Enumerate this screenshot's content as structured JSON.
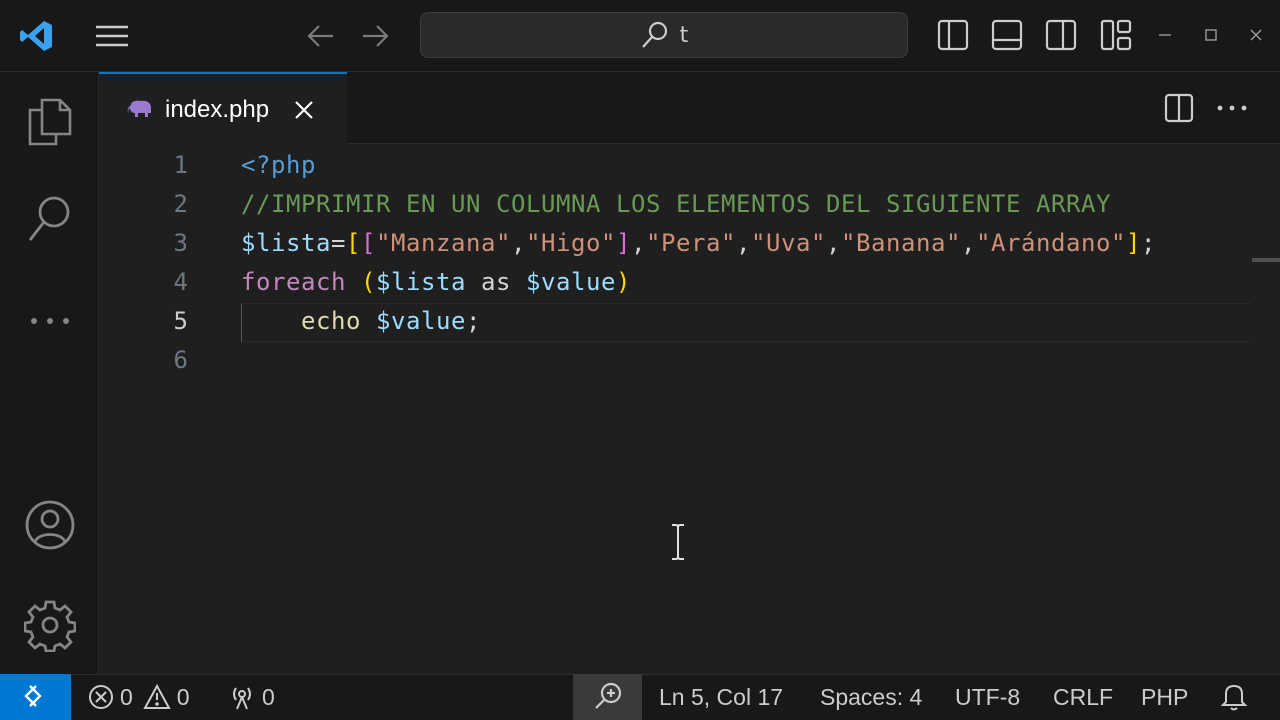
{
  "titlebar": {
    "search_text": "t"
  },
  "tab": {
    "label": "index.php",
    "icon": "php-elephant-icon"
  },
  "editor": {
    "line_numbers": [
      "1",
      "2",
      "3",
      "4",
      "5",
      "6"
    ],
    "active_line": 5,
    "lines": [
      {
        "segments": [
          {
            "cls": "k-tag",
            "text": "<?php"
          }
        ]
      },
      {
        "segments": [
          {
            "cls": "k-cmt",
            "text": "//IMPRIMIR EN UN COLUMNA LOS ELEMENTOS DEL SIGUIENTE ARRAY"
          }
        ]
      },
      {
        "segments": [
          {
            "cls": "k-var",
            "text": "$lista"
          },
          {
            "cls": "k-op",
            "text": "="
          },
          {
            "cls": "k-b1",
            "text": "["
          },
          {
            "cls": "k-b2",
            "text": "["
          },
          {
            "cls": "k-str",
            "text": "\"Manzana\""
          },
          {
            "cls": "k-op",
            "text": ","
          },
          {
            "cls": "k-str",
            "text": "\"Higo\""
          },
          {
            "cls": "k-b2",
            "text": "]"
          },
          {
            "cls": "k-op",
            "text": ","
          },
          {
            "cls": "k-str",
            "text": "\"Pera\""
          },
          {
            "cls": "k-op",
            "text": ","
          },
          {
            "cls": "k-str",
            "text": "\"Uva\""
          },
          {
            "cls": "k-op",
            "text": ","
          },
          {
            "cls": "k-str",
            "text": "\"Banana\""
          },
          {
            "cls": "k-op",
            "text": ","
          },
          {
            "cls": "k-str",
            "text": "\"Arándano\""
          },
          {
            "cls": "k-b1",
            "text": "]"
          },
          {
            "cls": "k-op",
            "text": ";"
          }
        ]
      },
      {
        "segments": [
          {
            "cls": "k-kw",
            "text": "foreach"
          },
          {
            "cls": "k-op",
            "text": " "
          },
          {
            "cls": "k-b1",
            "text": "("
          },
          {
            "cls": "k-var",
            "text": "$lista"
          },
          {
            "cls": "k-op",
            "text": " as "
          },
          {
            "cls": "k-var",
            "text": "$value"
          },
          {
            "cls": "k-b1",
            "text": ")"
          }
        ]
      },
      {
        "segments": [
          {
            "cls": "k-op",
            "text": "    "
          },
          {
            "cls": "k-fn",
            "text": "echo"
          },
          {
            "cls": "k-op",
            "text": " "
          },
          {
            "cls": "k-var",
            "text": "$value"
          },
          {
            "cls": "k-op",
            "text": ";"
          }
        ]
      },
      {
        "segments": []
      }
    ]
  },
  "statusbar": {
    "errors": "0",
    "warnings": "0",
    "ports": "0",
    "position": "Ln 5, Col 17",
    "spaces": "Spaces: 4",
    "encoding": "UTF-8",
    "eol": "CRLF",
    "language": "PHP"
  },
  "colors": {
    "accent": "#0078d4",
    "comment": "#6a9955",
    "string": "#ce9178",
    "variable": "#9cdcfe",
    "keyword": "#c586c0"
  }
}
